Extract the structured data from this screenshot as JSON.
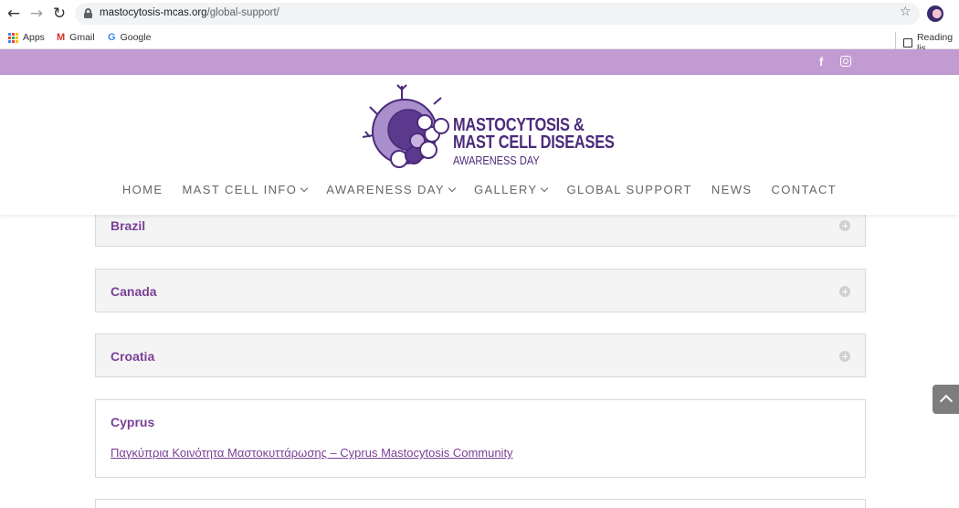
{
  "browser": {
    "url_host": "mastocytosis-mcas.org",
    "url_path": "/global-support/",
    "bookmarks": [
      "Apps",
      "Gmail",
      "Google"
    ],
    "reading_list": "Reading lis"
  },
  "site": {
    "logo_line1": "MASTOCYTOSIS &",
    "logo_line2": "MAST CELL DISEASES",
    "logo_line3": "AWARENESS DAY",
    "nav": [
      "HOME",
      "MAST CELL INFO",
      "AWARENESS DAY",
      "GALLERY",
      "GLOBAL SUPPORT",
      "NEWS",
      "CONTACT"
    ],
    "accent": "#7a3f96",
    "topbar_color": "#c29bd3"
  },
  "accordions": [
    {
      "title": "Brazil"
    },
    {
      "title": "Canada"
    },
    {
      "title": "Croatia"
    },
    {
      "title": "Cyprus",
      "link": "Παγκύπρια Κοινότητα Μαστοκυττάρωσης – Cyprus Mastocytosis Community"
    }
  ]
}
